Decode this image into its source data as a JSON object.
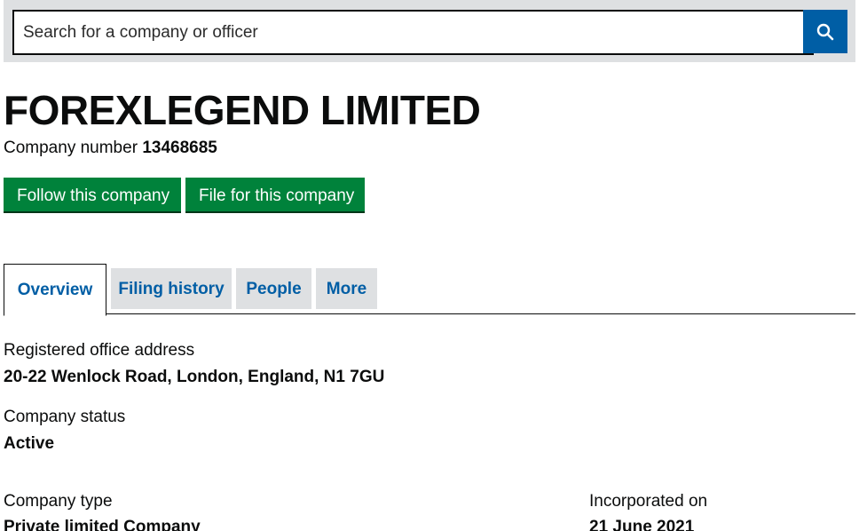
{
  "search": {
    "placeholder": "Search for a company or officer",
    "button_icon": "search-icon"
  },
  "company": {
    "name": "FOREXLEGEND LIMITED",
    "number_label": "Company number",
    "number": "13468685"
  },
  "actions": {
    "follow_label": "Follow this company",
    "file_label": "File for this company"
  },
  "tabs": [
    {
      "label": "Overview",
      "active": true
    },
    {
      "label": "Filing history",
      "active": false
    },
    {
      "label": "People",
      "active": false
    },
    {
      "label": "More",
      "active": false
    }
  ],
  "details": {
    "office_address_label": "Registered office address",
    "office_address": "20-22 Wenlock Road, London, England, N1 7GU",
    "status_label": "Company status",
    "status": "Active",
    "type_label": "Company type",
    "type": "Private limited Company",
    "incorporated_label": "Incorporated on",
    "incorporated": "21 June 2021"
  },
  "colors": {
    "link_blue": "#005ea5",
    "button_green": "#00823b",
    "panel_grey": "#dee0e2",
    "text": "#0b0c0c"
  }
}
